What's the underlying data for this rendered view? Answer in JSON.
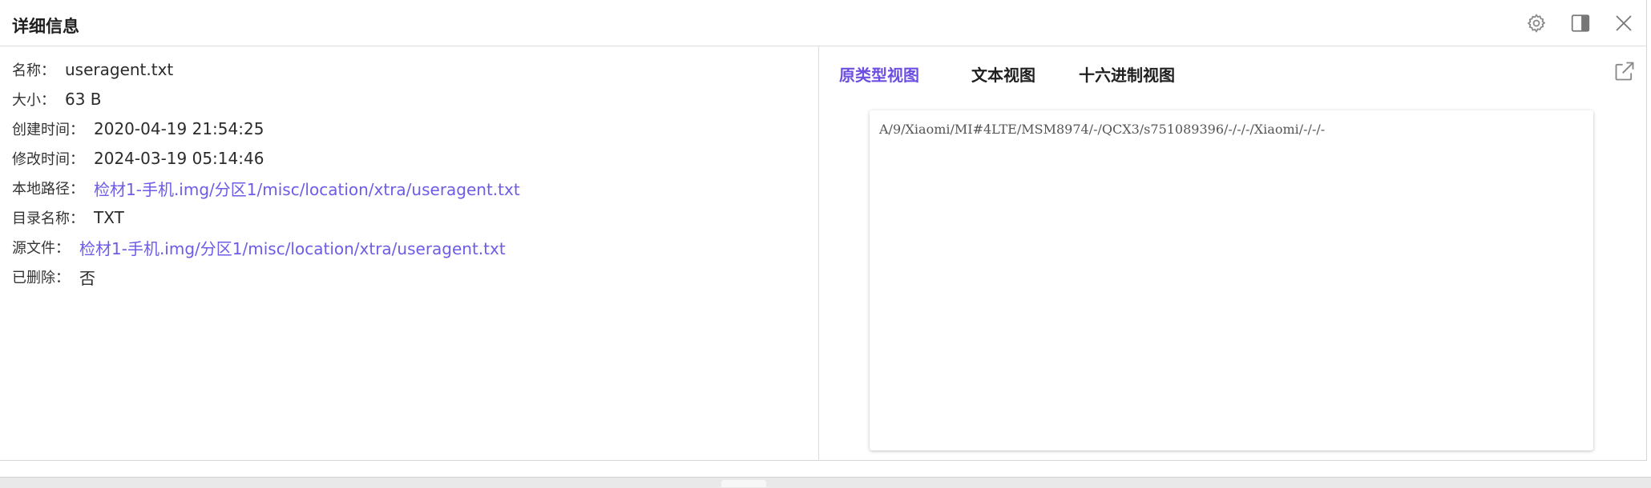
{
  "header": {
    "title": "详细信息",
    "settings_icon": "gear-icon",
    "layout_icon": "split-pane-icon",
    "close_icon": "close-icon"
  },
  "details": {
    "name": {
      "label": "名称：",
      "value": "useragent.txt"
    },
    "size": {
      "label": "大小：",
      "value": "63 B"
    },
    "created": {
      "label": "创建时间：",
      "value": "2020-04-19 21:54:25"
    },
    "modified": {
      "label": "修改时间：",
      "value": "2024-03-19 05:14:46"
    },
    "local_path": {
      "label": "本地路径：",
      "value": "检材1-手机.img/分区1/misc/location/xtra/useragent.txt"
    },
    "dir_name": {
      "label": "目录名称：",
      "value": "TXT"
    },
    "source_file": {
      "label": "源文件：",
      "value": "检材1-手机.img/分区1/misc/location/xtra/useragent.txt"
    },
    "deleted": {
      "label": "已删除：",
      "value": "否"
    }
  },
  "viewer": {
    "tabs": [
      {
        "label": "原类型视图",
        "active": true
      },
      {
        "label": "文本视图",
        "active": false
      },
      {
        "label": "十六进制视图",
        "active": false
      }
    ],
    "open_external_icon": "external-link-icon",
    "content": "A/9/Xiaomi/MI#4LTE/MSM8974/-/QCX3/s751089396/-/-/-/Xiaomi/-/-/-"
  },
  "colors": {
    "accent": "#6c4fe0",
    "link": "#6c5ce7"
  }
}
